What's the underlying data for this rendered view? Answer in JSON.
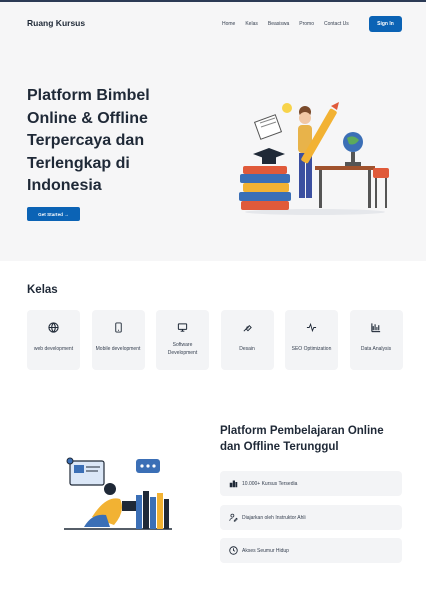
{
  "brand": "Ruang Kursus",
  "nav": {
    "links": [
      "Home",
      "Kelas",
      "Beasiswa",
      "Promo",
      "Contact Us"
    ],
    "signin": "Sign In"
  },
  "hero": {
    "title": "Platform Bimbel Online & Offline Terpercaya dan Terlengkap di Indonesia",
    "cta": "Get Started →"
  },
  "kelas": {
    "title": "Kelas",
    "cards": [
      {
        "label": "web development",
        "icon": "globe-icon"
      },
      {
        "label": "Mobile development",
        "icon": "smartphone-icon"
      },
      {
        "label": "Software Development",
        "icon": "monitor-icon"
      },
      {
        "label": "Desain",
        "icon": "pen-tool-icon"
      },
      {
        "label": "SEO Optimization",
        "icon": "activity-icon"
      },
      {
        "label": "Data Analysis",
        "icon": "bar-chart-icon"
      }
    ]
  },
  "platform": {
    "title": "Platform Pembelajaran Online dan Offline Terunggul",
    "features": [
      {
        "text": "10.000+ Kursus Tersedia",
        "icon": "books-icon"
      },
      {
        "text": "Diajarkan oleh Instruktor Ahli",
        "icon": "instructor-icon"
      },
      {
        "text": "Akses Seumur Hidup",
        "icon": "clock-icon"
      }
    ]
  },
  "colors": {
    "accent": "#0b63b5",
    "hero_bg": "#f6f6f7",
    "card_bg": "#f3f4f6"
  }
}
